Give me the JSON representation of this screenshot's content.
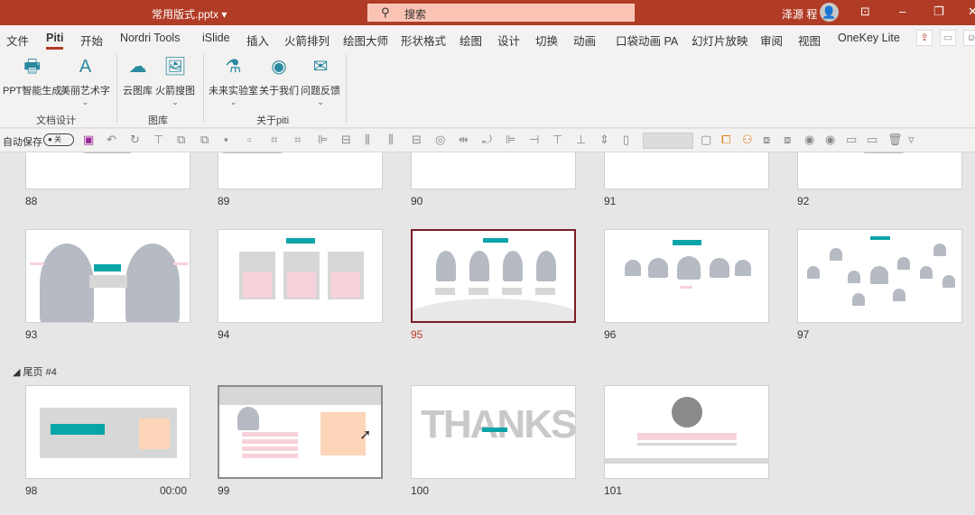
{
  "titlebar": {
    "doc_title": "常用版式.pptx ▾",
    "search_placeholder": "搜索",
    "search_icon": "search-icon",
    "user_name": "泽源 程",
    "controls": [
      "ribbon-display-icon",
      "minimize-icon",
      "restore-icon",
      "close-icon"
    ]
  },
  "tabs": [
    {
      "label": "文件"
    },
    {
      "label": "Piti",
      "active": true
    },
    {
      "label": "开始"
    },
    {
      "label": "Nordri Tools"
    },
    {
      "label": "iSlide"
    },
    {
      "label": "插入"
    },
    {
      "label": "火箭排列"
    },
    {
      "label": "绘图大师"
    },
    {
      "label": "形状格式"
    },
    {
      "label": "绘图"
    },
    {
      "label": "设计"
    },
    {
      "label": "切换"
    },
    {
      "label": "动画"
    },
    {
      "label": "口袋动画 PA"
    },
    {
      "label": "幻灯片放映"
    },
    {
      "label": "审阅"
    },
    {
      "label": "视图"
    },
    {
      "label": "OneKey Lite"
    }
  ],
  "ribbon": {
    "groups": [
      {
        "label": "文档设计",
        "buttons": [
          {
            "label": "PPT智能生成",
            "icon": "document-generate-icon"
          },
          {
            "label": "美丽艺术字",
            "icon": "art-text-icon",
            "dropdown": true
          }
        ]
      },
      {
        "label": "图库",
        "buttons": [
          {
            "label": "云图库",
            "icon": "cloud-gallery-icon"
          },
          {
            "label": "火箭搜图",
            "icon": "image-search-icon",
            "dropdown": true
          }
        ]
      },
      {
        "label": "关于piti",
        "buttons": [
          {
            "label": "未来实验室",
            "icon": "lab-flask-icon",
            "dropdown": true
          },
          {
            "label": "关于我们",
            "icon": "about-icon"
          },
          {
            "label": "问题反馈",
            "icon": "feedback-mail-icon",
            "dropdown": true
          }
        ]
      }
    ]
  },
  "qat": {
    "autosave_label": "自动保存",
    "autosave_state": "关",
    "icons": [
      "save-icon",
      "undo-icon",
      "redo-icon",
      "present-icon",
      "bring-forward-icon",
      "send-backward-icon",
      "bring-front-icon",
      "send-back-icon",
      "group-icon",
      "ungroup-icon",
      "align-left-icon",
      "align-center-icon",
      "distribute-h-icon",
      "distribute-v-icon",
      "align-middle-icon",
      "merge-shapes-icon",
      "flip-icon",
      "rotate-icon",
      "align-left-edge-icon",
      "align-right-edge-icon",
      "align-top-icon",
      "align-bottom-icon",
      "same-height-icon",
      "new-page-icon",
      "textbox-icon",
      "selection-pane-icon",
      "touch-mode-icon",
      "shape-outline-icon",
      "shape-fill-icon",
      "circle-icon",
      "circle2-icon",
      "copy-icon",
      "paste-icon",
      "delete-icon",
      "customize-icon"
    ]
  },
  "sorter": {
    "section_label": "尾页 #4",
    "row1": [
      "88",
      "89",
      "90",
      "91",
      "92"
    ],
    "row2": [
      "93",
      "94",
      "95",
      "96",
      "97"
    ],
    "row3": [
      "98",
      "99",
      "100",
      "101"
    ],
    "selected": "95",
    "slide_98_time": "00:00",
    "thanks_text": "THANKS"
  },
  "colors": {
    "accent": "#b13c26",
    "teal": "#0aa5a8",
    "selected_border": "#7b1c24"
  }
}
